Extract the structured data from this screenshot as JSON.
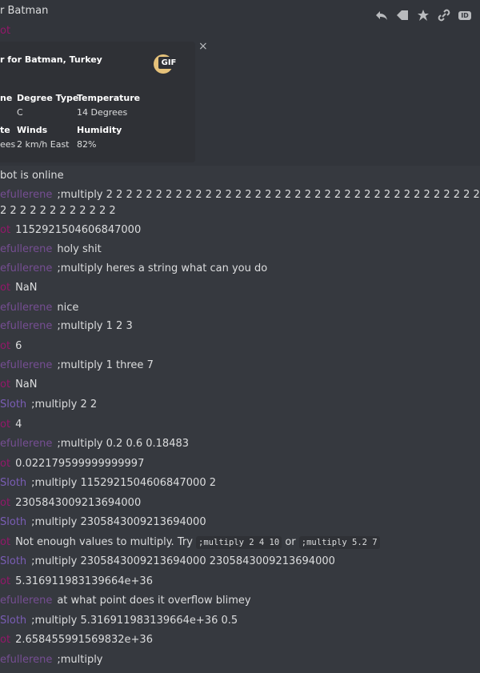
{
  "header": {
    "channel_title": "r Batman"
  },
  "top_author": "ot",
  "toolbar": {
    "reply_icon": "reply-icon",
    "react_icon": "react-icon",
    "pin_icon": "pin-icon",
    "link_icon": "link-icon",
    "id_label": "ID"
  },
  "embed": {
    "title": "r for Batman, Turkey",
    "gif_label": "GIF",
    "close": "×",
    "fields": [
      {
        "name": "ne",
        "value": ""
      },
      {
        "name": "Degree Type",
        "value": "C"
      },
      {
        "name": "Temperature",
        "value": "14 Degrees"
      },
      {
        "name": "te",
        "value": "ees"
      },
      {
        "name": "Winds",
        "value": "2 km/h East"
      },
      {
        "name": "Humidity",
        "value": "82%"
      }
    ]
  },
  "messages": [
    {
      "author": "",
      "text": "bot is online"
    },
    {
      "author": "efullerene",
      "text": ";multiply 2 2 2 2 2 2 2 2 2 2 2 2 2 2 2 2 2 2 2 2 2 2 2 2 2 2 2 2 2 2 2 2 2 2 2 2 2 2 2 2 2 2 2 2 2 2 2 2 2"
    },
    {
      "author": "",
      "text": "2 2 2 2 2 2 2 2 2 2 2 2"
    },
    {
      "author": "ot",
      "text": "1152921504606847000"
    },
    {
      "author": "efullerene",
      "text": "holy shit"
    },
    {
      "author": "efullerene",
      "text": ";multiply heres a string what can you do"
    },
    {
      "author": "ot",
      "text": "NaN"
    },
    {
      "author": "efullerene",
      "text": "nice"
    },
    {
      "author": "efullerene",
      "text": ";multiply 1 2 3"
    },
    {
      "author": "ot",
      "text": "6"
    },
    {
      "author": "efullerene",
      "text": ";multiply 1 three 7"
    },
    {
      "author": "ot",
      "text": "NaN"
    },
    {
      "author": "Sloth",
      "text": ";multiply 2 2"
    },
    {
      "author": "ot",
      "text": "4"
    },
    {
      "author": "efullerene",
      "text": ";multiply 0.2 0.6 0.18483"
    },
    {
      "author": "ot",
      "text": "0.022179599999999997"
    },
    {
      "author": "Sloth",
      "text": ";multiply 1152921504606847000 2"
    },
    {
      "author": "ot",
      "text": "2305843009213694000"
    },
    {
      "author": "Sloth",
      "text": ";multiply 2305843009213694000"
    },
    {
      "author": "ot",
      "text": "Not enough values to multiply. Try",
      "code1": ";multiply 2 4 10",
      "mid": "or",
      "code2": ";multiply 5.2 7"
    },
    {
      "author": "Sloth",
      "text": ";multiply 2305843009213694000 2305843009213694000"
    },
    {
      "author": "ot",
      "text": "5.316911983139664e+36"
    },
    {
      "author": "efullerene",
      "text": "at what point does it overflow blimey"
    },
    {
      "author": "Sloth",
      "text": ";multiply 5.316911983139664e+36 0.5"
    },
    {
      "author": "ot",
      "text": "2.658455991569832e+36"
    },
    {
      "author": "efullerene",
      "text": ";multiply"
    }
  ],
  "colors": {
    "background": "#36393f",
    "embed_bg": "#2f3136",
    "bot_author": "#93176a",
    "fullerene_author": "#764e93",
    "sloth_author": "#7a5db5"
  }
}
